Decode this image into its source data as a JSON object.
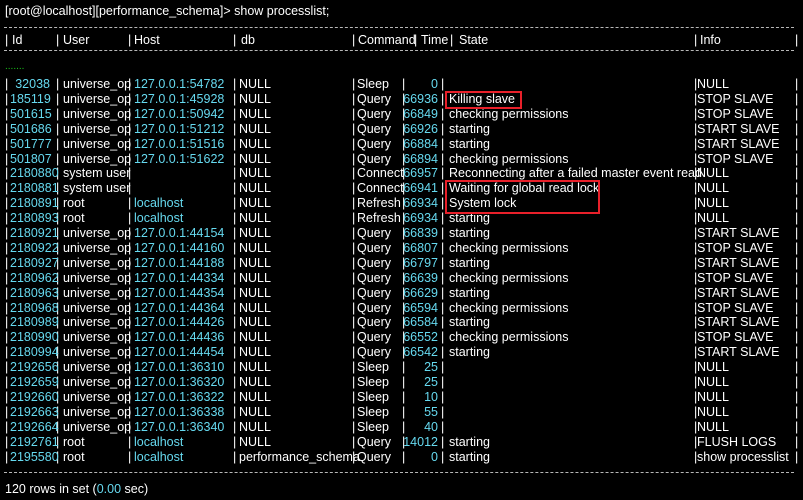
{
  "prompt": "[root@localhost][performance_schema]> show processlist;",
  "headers": {
    "id": "Id",
    "user": "User",
    "host": "Host",
    "db": "db",
    "command": "Command",
    "time": "Time",
    "state": "State",
    "info": "Info"
  },
  "ellipsis": ".......",
  "rows": [
    {
      "id": "32038",
      "user": "universe_op",
      "host": "127.0.0.1:54782",
      "db": "NULL",
      "command": "Sleep",
      "time": "0",
      "state": "",
      "info": "NULL"
    },
    {
      "id": "185119",
      "user": "universe_op",
      "host": "127.0.0.1:45928",
      "db": "NULL",
      "command": "Query",
      "time": "66936",
      "state": "Killing slave",
      "info": "STOP SLAVE"
    },
    {
      "id": "501615",
      "user": "universe_op",
      "host": "127.0.0.1:50942",
      "db": "NULL",
      "command": "Query",
      "time": "66849",
      "state": "checking permissions",
      "info": "STOP SLAVE"
    },
    {
      "id": "501686",
      "user": "universe_op",
      "host": "127.0.0.1:51212",
      "db": "NULL",
      "command": "Query",
      "time": "66926",
      "state": "starting",
      "info": "START SLAVE"
    },
    {
      "id": "501777",
      "user": "universe_op",
      "host": "127.0.0.1:51516",
      "db": "NULL",
      "command": "Query",
      "time": "66884",
      "state": "starting",
      "info": "START SLAVE"
    },
    {
      "id": "501807",
      "user": "universe_op",
      "host": "127.0.0.1:51622",
      "db": "NULL",
      "command": "Query",
      "time": "66894",
      "state": "checking permissions",
      "info": "STOP SLAVE"
    },
    {
      "id": "2180880",
      "user": "system user",
      "host": "",
      "db": "NULL",
      "command": "Connect",
      "time": "66957",
      "state": "Reconnecting after a failed master event read",
      "info": "NULL"
    },
    {
      "id": "2180881",
      "user": "system user",
      "host": "",
      "db": "NULL",
      "command": "Connect",
      "time": "66941",
      "state": "Waiting for global read lock",
      "info": "NULL"
    },
    {
      "id": "2180891",
      "user": "root",
      "host": "localhost",
      "db": "NULL",
      "command": "Refresh",
      "time": "66934",
      "state": "System lock",
      "info": "NULL"
    },
    {
      "id": "2180893",
      "user": "root",
      "host": "localhost",
      "db": "NULL",
      "command": "Refresh",
      "time": "66934",
      "state": "starting",
      "info": "NULL"
    },
    {
      "id": "2180921",
      "user": "universe_op",
      "host": "127.0.0.1:44154",
      "db": "NULL",
      "command": "Query",
      "time": "66839",
      "state": "starting",
      "info": "START SLAVE"
    },
    {
      "id": "2180922",
      "user": "universe_op",
      "host": "127.0.0.1:44160",
      "db": "NULL",
      "command": "Query",
      "time": "66807",
      "state": "checking permissions",
      "info": "STOP SLAVE"
    },
    {
      "id": "2180927",
      "user": "universe_op",
      "host": "127.0.0.1:44188",
      "db": "NULL",
      "command": "Query",
      "time": "66797",
      "state": "starting",
      "info": "START SLAVE"
    },
    {
      "id": "2180962",
      "user": "universe_op",
      "host": "127.0.0.1:44334",
      "db": "NULL",
      "command": "Query",
      "time": "66639",
      "state": "checking permissions",
      "info": "STOP SLAVE"
    },
    {
      "id": "2180963",
      "user": "universe_op",
      "host": "127.0.0.1:44354",
      "db": "NULL",
      "command": "Query",
      "time": "66629",
      "state": "starting",
      "info": "START SLAVE"
    },
    {
      "id": "2180968",
      "user": "universe_op",
      "host": "127.0.0.1:44364",
      "db": "NULL",
      "command": "Query",
      "time": "66594",
      "state": "checking permissions",
      "info": "STOP SLAVE"
    },
    {
      "id": "2180989",
      "user": "universe_op",
      "host": "127.0.0.1:44426",
      "db": "NULL",
      "command": "Query",
      "time": "66584",
      "state": "starting",
      "info": "START SLAVE"
    },
    {
      "id": "2180990",
      "user": "universe_op",
      "host": "127.0.0.1:44436",
      "db": "NULL",
      "command": "Query",
      "time": "66552",
      "state": "checking permissions",
      "info": "STOP SLAVE"
    },
    {
      "id": "2180994",
      "user": "universe_op",
      "host": "127.0.0.1:44454",
      "db": "NULL",
      "command": "Query",
      "time": "66542",
      "state": "starting",
      "info": "START SLAVE"
    },
    {
      "id": "2192656",
      "user": "universe_op",
      "host": "127.0.0.1:36310",
      "db": "NULL",
      "command": "Sleep",
      "time": "25",
      "state": "",
      "info": "NULL"
    },
    {
      "id": "2192659",
      "user": "universe_op",
      "host": "127.0.0.1:36320",
      "db": "NULL",
      "command": "Sleep",
      "time": "25",
      "state": "",
      "info": "NULL"
    },
    {
      "id": "2192660",
      "user": "universe_op",
      "host": "127.0.0.1:36322",
      "db": "NULL",
      "command": "Sleep",
      "time": "10",
      "state": "",
      "info": "NULL"
    },
    {
      "id": "2192663",
      "user": "universe_op",
      "host": "127.0.0.1:36338",
      "db": "NULL",
      "command": "Sleep",
      "time": "55",
      "state": "",
      "info": "NULL"
    },
    {
      "id": "2192664",
      "user": "universe_op",
      "host": "127.0.0.1:36340",
      "db": "NULL",
      "command": "Sleep",
      "time": "40",
      "state": "",
      "info": "NULL"
    },
    {
      "id": "2192761",
      "user": "root",
      "host": "localhost",
      "db": "NULL",
      "command": "Query",
      "time": "14012",
      "state": "starting",
      "info": "FLUSH LOGS"
    },
    {
      "id": "2195580",
      "user": "root",
      "host": "localhost",
      "db": "performance_schema",
      "command": "Query",
      "time": "0",
      "state": "starting",
      "info": "show processlist"
    }
  ],
  "footer": {
    "prefix": "120 rows in set (",
    "duration": "0.00",
    "suffix": " sec)"
  },
  "highlight_color": "#e8202a",
  "accent_color": "#66d9ef"
}
